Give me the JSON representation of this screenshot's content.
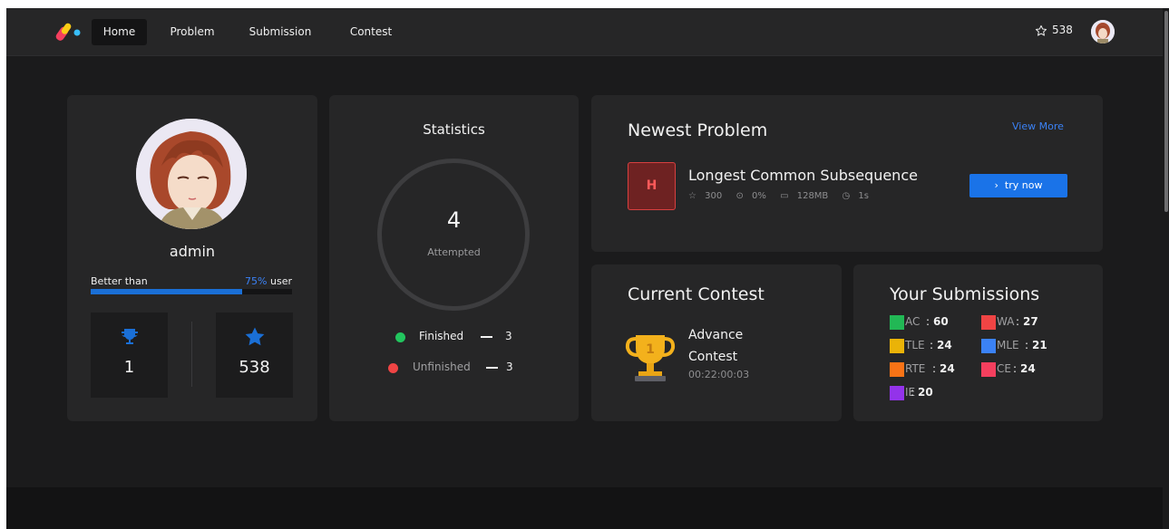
{
  "nav": {
    "items": [
      {
        "label": "Home",
        "active": true
      },
      {
        "label": "Problem",
        "active": false
      },
      {
        "label": "Submission",
        "active": false
      },
      {
        "label": "Contest",
        "active": false
      }
    ],
    "star_count": "538"
  },
  "profile": {
    "username": "admin",
    "better_than_label": "Better than",
    "better_than_percent": "75%",
    "better_than_suffix": " user",
    "better_than_fraction": 0.75,
    "trophies": "1",
    "stars": "538"
  },
  "statistics": {
    "title": "Statistics",
    "attempted_count": "4",
    "attempted_label": "Attempted",
    "finished_label": "Finished",
    "finished_count": "3",
    "unfinished_label": "Unfinished",
    "unfinished_count": "3"
  },
  "newest_problem": {
    "title": "Newest Problem",
    "view_more": "View More",
    "difficulty": "H",
    "problem_name": "Longest Common Subsequence",
    "points": "300",
    "acceptance": "0%",
    "memory": "128MB",
    "time": "1s",
    "try_label": "try now"
  },
  "current_contest": {
    "title": "Current Contest",
    "name": "Advance Contest",
    "countdown": "00:22:00:03"
  },
  "submissions": {
    "title": "Your Submissions",
    "items": [
      {
        "label": "AC",
        "value": "60",
        "color": "#22b855"
      },
      {
        "label": "WA",
        "value": "27",
        "color": "#ef4444"
      },
      {
        "label": "TLE",
        "value": "24",
        "color": "#eab308"
      },
      {
        "label": "MLE",
        "value": "21",
        "color": "#3b82f6"
      },
      {
        "label": "RTE",
        "value": "24",
        "color": "#f97316"
      },
      {
        "label": "CE",
        "value": "24",
        "color": "#f43f5e"
      },
      {
        "label": "IE",
        "value": "20",
        "color": "#9333ea"
      }
    ]
  },
  "colors": {
    "accent": "#1a73e8",
    "finished": "#22c55e",
    "unfinished": "#ef4444"
  }
}
